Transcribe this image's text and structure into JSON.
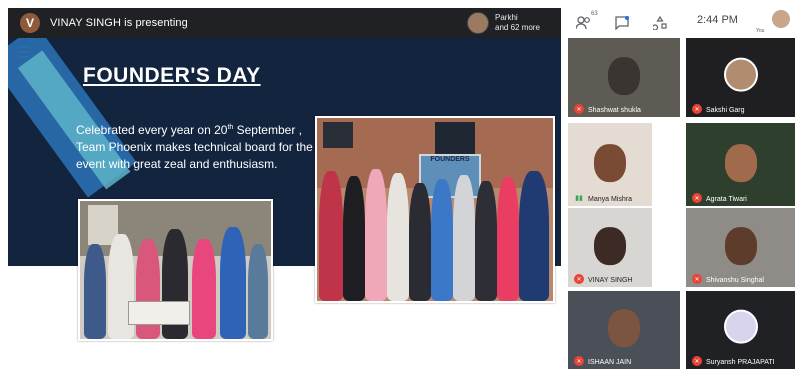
{
  "presenter": {
    "initial": "V",
    "text": "VINAY SINGH is presenting"
  },
  "viewers": {
    "line1": "Parkhi",
    "line2": "and 62 more"
  },
  "toolbar": {
    "people_count": "63",
    "time": "2:44 PM",
    "you_label": "You"
  },
  "slide": {
    "title": "FOUNDER'S DAY",
    "body_part1": "Celebrated every  year on 20",
    "body_sup": "th",
    "body_part2": " September , Team Phoenix makes technical board for the event with great zeal and enthusiasm."
  },
  "photo2_sign": "FOUNDERS",
  "participants": [
    {
      "name": "Shashwat shukla",
      "mic": "muted"
    },
    {
      "name": "Sakshi Garg",
      "mic": "muted"
    },
    {
      "name": "Manya Mishra",
      "mic": "on"
    },
    {
      "name": "Agrata Tiwari",
      "mic": "muted"
    },
    {
      "name": "VINAY SINGH",
      "mic": "muted"
    },
    {
      "name": "Shivanshu Singhal",
      "mic": "muted"
    },
    {
      "name": "ISHAAN JAIN",
      "mic": "muted"
    },
    {
      "name": "Suryansh PRAJAPATI",
      "mic": "muted"
    }
  ]
}
